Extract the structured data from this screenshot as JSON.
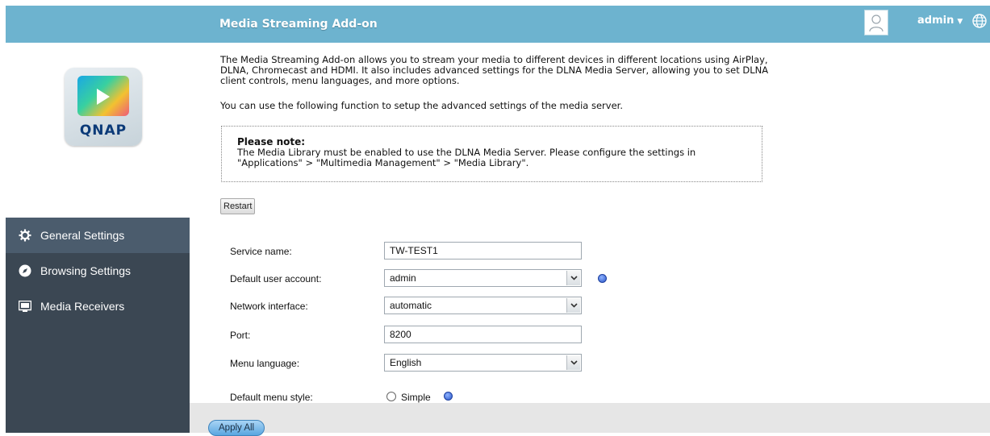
{
  "header": {
    "title": "Media Streaming Add-on",
    "user": "admin"
  },
  "logo": {
    "brand": "QNAP"
  },
  "intro": {
    "paragraph1": "The Media Streaming Add-on allows you to stream your media to different devices in different locations using AirPlay, DLNA, Chromecast and HDMI. It also includes advanced settings for the DLNA Media Server, allowing you to set DLNA client controls, menu languages, and more options.",
    "paragraph2": "You can use the following function to setup the advanced settings of the media server."
  },
  "note": {
    "title": "Please note:",
    "body": "The Media Library must be enabled to use the DLNA Media Server. Please configure the settings in \"Applications\" > \"Multimedia Management\" > \"Media Library\"."
  },
  "buttons": {
    "restart": "Restart",
    "apply_all": "Apply All"
  },
  "sidebar": {
    "items": [
      {
        "label": "General Settings",
        "icon": "gear-icon",
        "active": true
      },
      {
        "label": "Browsing Settings",
        "icon": "compass-icon",
        "active": false
      },
      {
        "label": "Media Receivers",
        "icon": "monitor-icon",
        "active": false
      }
    ]
  },
  "form": {
    "service_name": {
      "label": "Service name:",
      "value": "TW-TEST1"
    },
    "default_user_account": {
      "label": "Default user account:",
      "value": "admin"
    },
    "network_interface": {
      "label": "Network interface:",
      "value": "automatic"
    },
    "port": {
      "label": "Port:",
      "value": "8200"
    },
    "menu_language": {
      "label": "Menu language:",
      "value": "English"
    },
    "default_menu_style": {
      "label": "Default menu style:",
      "option": "Simple"
    }
  },
  "colors": {
    "header_bg": "#6db3cf",
    "sidebar_bg": "#3b4753",
    "sidebar_active": "#4b5c6d",
    "button_blue": "#5aa6e0"
  }
}
